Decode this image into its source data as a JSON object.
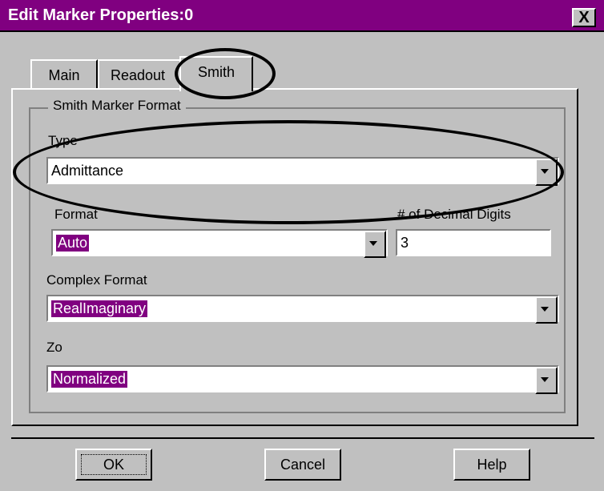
{
  "window": {
    "title": "Edit Marker Properties:0",
    "close_label": "X"
  },
  "tabs": [
    {
      "label": "Main",
      "selected": false
    },
    {
      "label": "Readout",
      "selected": false
    },
    {
      "label": "Smith",
      "selected": true
    }
  ],
  "group": {
    "label": "Smith Marker Format",
    "type": {
      "label": "Type",
      "value": "Admittance"
    },
    "format": {
      "label": "Format",
      "value": "Auto"
    },
    "decimal": {
      "label": "# of Decimal Digits",
      "value": "3"
    },
    "complex": {
      "label": "Complex Format",
      "value": "RealImaginary"
    },
    "zo": {
      "label": "Zo",
      "value": "Normalized"
    }
  },
  "buttons": {
    "ok": "OK",
    "cancel": "Cancel",
    "help": "Help"
  },
  "colors": {
    "title_bar": "#800080",
    "selection": "#800080",
    "face": "#c0c0c0"
  }
}
